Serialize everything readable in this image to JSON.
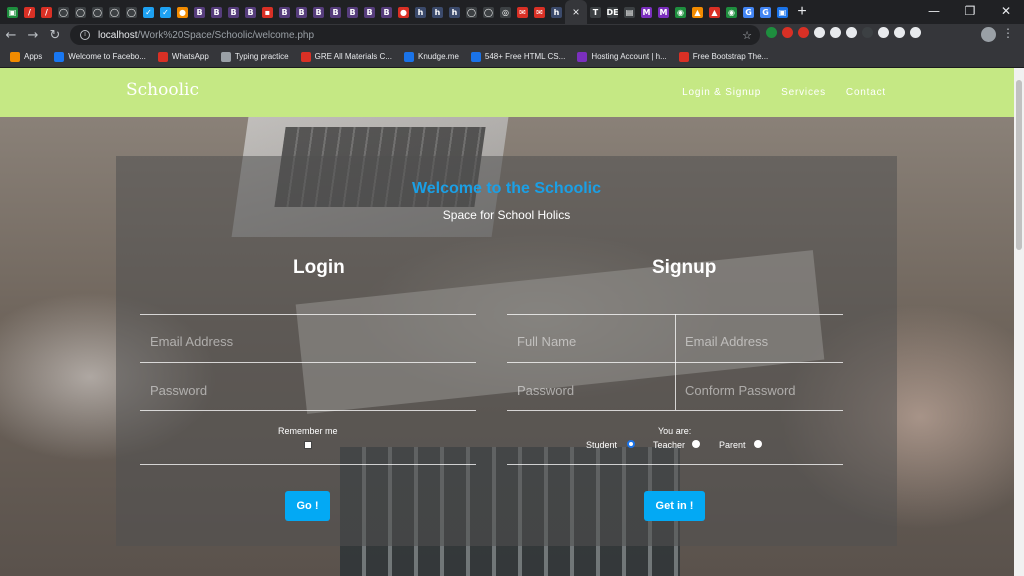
{
  "browser": {
    "active_tab_close": "×",
    "new_tab": "+",
    "window_controls": {
      "minimize": "—",
      "maximize": "❐",
      "close": "✕"
    },
    "url_host": "localhost",
    "url_path": "/Work%20Space/Schoolic/welcome.php",
    "tabs": [
      {
        "glyph": "▣",
        "color": "#1e8e3e"
      },
      {
        "glyph": "/",
        "color": "#d93025"
      },
      {
        "glyph": "/",
        "color": "#d93025"
      },
      {
        "glyph": "◯",
        "color": "#3c4043"
      },
      {
        "glyph": "◯",
        "color": "#3c4043"
      },
      {
        "glyph": "◯",
        "color": "#3c4043"
      },
      {
        "glyph": "◯",
        "color": "#3c4043"
      },
      {
        "glyph": "◯",
        "color": "#3c4043"
      },
      {
        "glyph": "✓",
        "color": "#1da1f2"
      },
      {
        "glyph": "✓",
        "color": "#1da1f2"
      },
      {
        "glyph": "●",
        "color": "#f28b00"
      },
      {
        "glyph": "B",
        "color": "#563d7c"
      },
      {
        "glyph": "B",
        "color": "#563d7c"
      },
      {
        "glyph": "B",
        "color": "#563d7c"
      },
      {
        "glyph": "B",
        "color": "#563d7c"
      },
      {
        "glyph": "▪",
        "color": "#d93025"
      },
      {
        "glyph": "B",
        "color": "#563d7c"
      },
      {
        "glyph": "B",
        "color": "#563d7c"
      },
      {
        "glyph": "B",
        "color": "#563d7c"
      },
      {
        "glyph": "B",
        "color": "#563d7c"
      },
      {
        "glyph": "B",
        "color": "#563d7c"
      },
      {
        "glyph": "B",
        "color": "#563d7c"
      },
      {
        "glyph": "B",
        "color": "#563d7c"
      },
      {
        "glyph": "●",
        "color": "#d93025"
      },
      {
        "glyph": "h",
        "color": "#3b4a6b"
      },
      {
        "glyph": "h",
        "color": "#3b4a6b"
      },
      {
        "glyph": "h",
        "color": "#3b4a6b"
      },
      {
        "glyph": "◯",
        "color": "#3c4043"
      },
      {
        "glyph": "◯",
        "color": "#3c4043"
      },
      {
        "glyph": "◎",
        "color": "#3c4043"
      },
      {
        "glyph": "✉",
        "color": "#d93025"
      },
      {
        "glyph": "✉",
        "color": "#d93025"
      },
      {
        "glyph": "h",
        "color": "#3b4a6b"
      }
    ],
    "tabs_after": [
      {
        "glyph": "T",
        "color": "#3c4043"
      },
      {
        "glyph": "DE",
        "color": "#3c4043"
      },
      {
        "glyph": "▤",
        "color": "#3c4043"
      },
      {
        "glyph": "M",
        "color": "#7b2fbe"
      },
      {
        "glyph": "M",
        "color": "#7b2fbe"
      },
      {
        "glyph": "◉",
        "color": "#1e8e3e"
      },
      {
        "glyph": "▲",
        "color": "#f28b00"
      },
      {
        "glyph": "▲",
        "color": "#d93025"
      },
      {
        "glyph": "◉",
        "color": "#1e8e3e"
      },
      {
        "glyph": "G",
        "color": "#4285f4"
      },
      {
        "glyph": "G",
        "color": "#4285f4"
      },
      {
        "glyph": "▣",
        "color": "#1a73e8"
      }
    ],
    "extensions": [
      "#1e8e3e",
      "#d93025",
      "#d93025",
      "#e8eaed",
      "#e8eaed",
      "#e8eaed",
      "#3c4043",
      "#e8eaed",
      "#e8eaed",
      "#e8eaed"
    ],
    "bookmarks": [
      {
        "label": "Apps",
        "icon": "apps-grid-icon",
        "color": "#f28b00"
      },
      {
        "label": "Welcome to Facebo...",
        "icon": "facebook-icon",
        "color": "#1877f2"
      },
      {
        "label": "WhatsApp",
        "icon": "whatsapp-icon",
        "color": "#d93025"
      },
      {
        "label": "Typing practice",
        "icon": "typing-icon",
        "color": "#9aa0a6"
      },
      {
        "label": "GRE All Materials C...",
        "icon": "gre-icon",
        "color": "#d93025"
      },
      {
        "label": "Knudge.me",
        "icon": "knudge-icon",
        "color": "#1a73e8"
      },
      {
        "label": "548+ Free HTML CS...",
        "icon": "tm-icon",
        "color": "#1a73e8"
      },
      {
        "label": "Hosting Account | h...",
        "icon": "hosting-icon",
        "color": "#7b2fbe"
      },
      {
        "label": "Free Bootstrap The...",
        "icon": "bootstrap-icon",
        "color": "#d93025"
      }
    ]
  },
  "site": {
    "brand": "Schoolic",
    "nav": [
      "Login & Signup",
      "Services",
      "Contact"
    ],
    "welcome": "Welcome to the Schoolic",
    "tagline": "Space for School Holics",
    "login": {
      "title": "Login",
      "email_placeholder": "Email Address",
      "password_placeholder": "Password",
      "remember_label": "Remember me",
      "button": "Go !"
    },
    "signup": {
      "title": "Signup",
      "fullname_placeholder": "Full Name",
      "email_placeholder": "Email Address",
      "password_placeholder": "Password",
      "confirm_placeholder": "Conform Password",
      "role_label": "You are:",
      "roles": [
        "Student",
        "Teacher",
        "Parent"
      ],
      "selected_role": "Student",
      "button": "Get in !"
    },
    "accent_color": "#c5e884",
    "button_color": "#03a9f4",
    "welcome_color": "#1aa0e6"
  }
}
